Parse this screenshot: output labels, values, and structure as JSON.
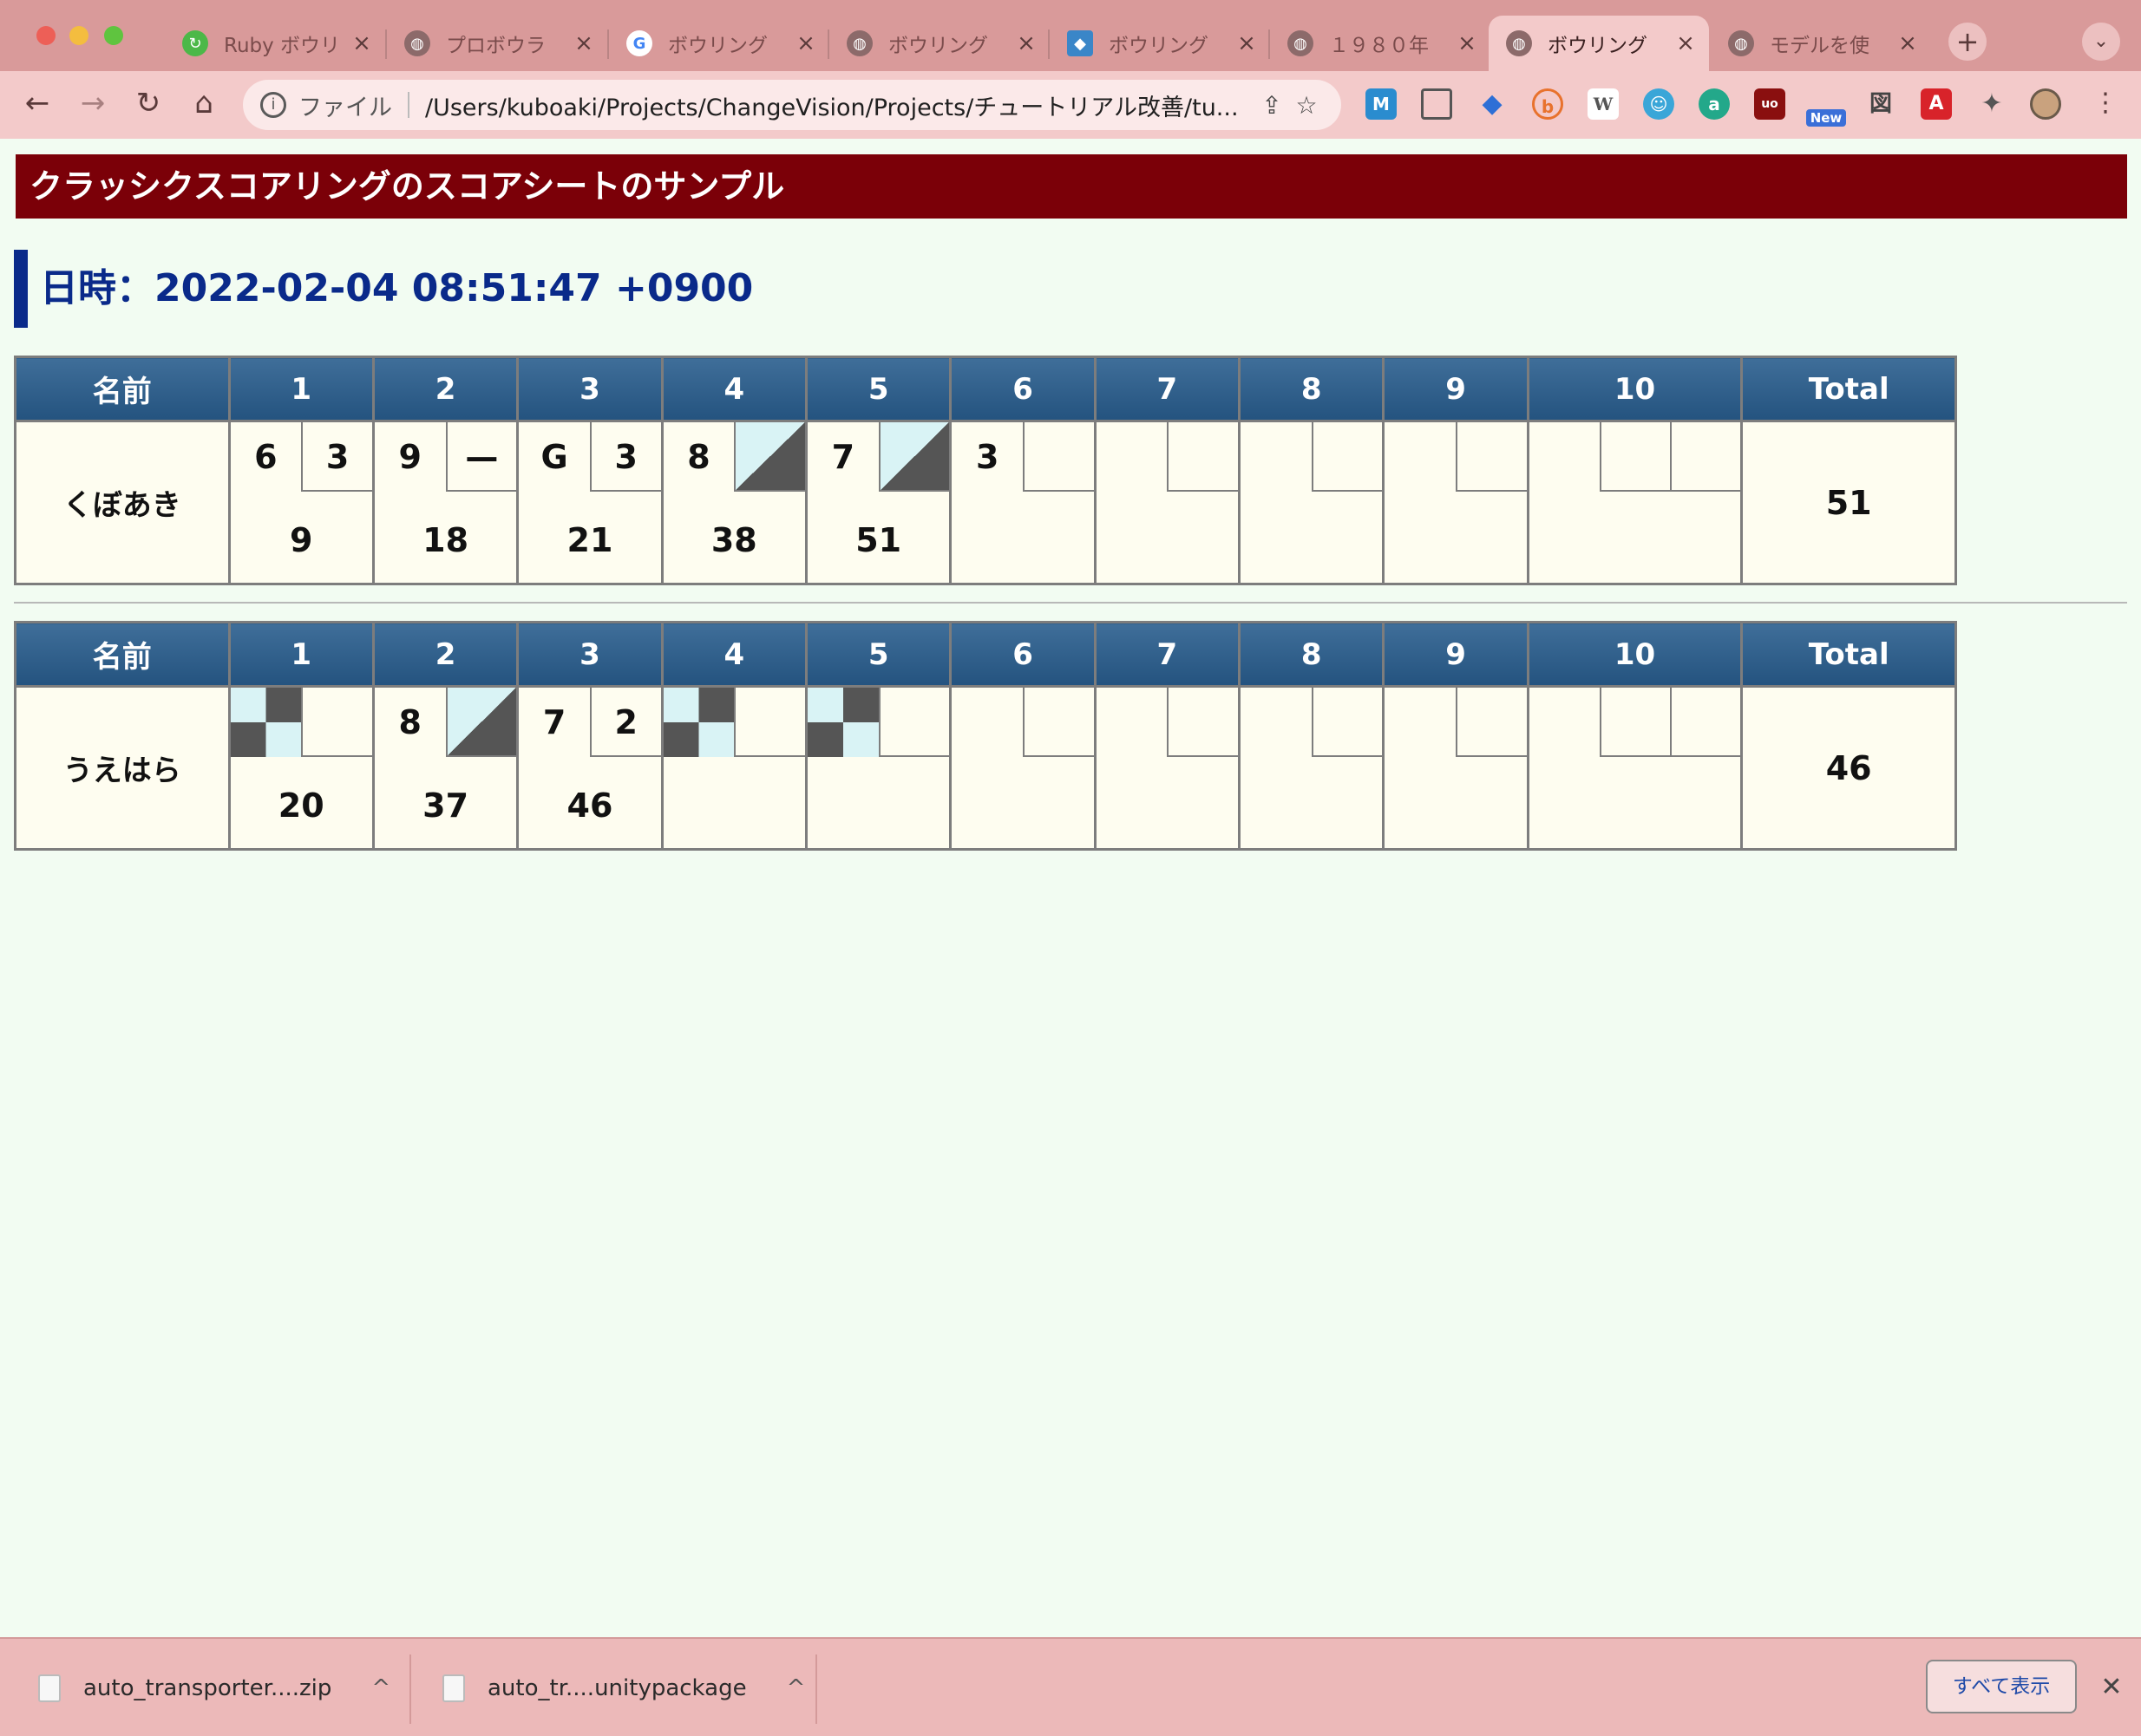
{
  "browser": {
    "tabs": [
      {
        "title": "Ruby ボウリ",
        "icon": "ruby-logo-icon"
      },
      {
        "title": "プロボウラ",
        "icon": "globe-icon"
      },
      {
        "title": "ボウリング",
        "icon": "google-icon"
      },
      {
        "title": "ボウリング",
        "icon": "globe-icon"
      },
      {
        "title": "ボウリング",
        "icon": "site-logo-icon"
      },
      {
        "title": "１９８０年",
        "icon": "globe-icon"
      },
      {
        "title": "ボウリング",
        "icon": "globe-icon",
        "active": true
      },
      {
        "title": "モデルを使",
        "icon": "globe-icon"
      }
    ],
    "address_scheme": "ファイル",
    "address_url": "/Users/kuboaki/Projects/ChangeVision/Projects/チュートリアル改善/tu...",
    "extensions": [
      {
        "name": "m-icon",
        "label": "M",
        "color": "#2a8ccf"
      },
      {
        "name": "screenshot-icon",
        "label": "▢",
        "color": "#555555"
      },
      {
        "name": "diamond-icon",
        "label": "◆",
        "color": "#2d6fd6"
      },
      {
        "name": "b-icon",
        "label": "b",
        "color": "#e8722d"
      },
      {
        "name": "w-icon",
        "label": "W",
        "color": "#999999"
      },
      {
        "name": "ghost-icon",
        "label": "0",
        "color": "#3aa6d8"
      },
      {
        "name": "a-icon",
        "label": "a",
        "color": "#23a88a"
      },
      {
        "name": "ublock-icon",
        "label": "uo",
        "color": "#8a0f0f"
      },
      {
        "name": "new-ext-icon",
        "label": "New",
        "color": "#3a6fd8"
      },
      {
        "name": "qr-icon",
        "label": "図",
        "color": "#444444"
      },
      {
        "name": "acrobat-icon",
        "label": "A",
        "color": "#d8232a"
      },
      {
        "name": "puzzle-icon",
        "label": "✦",
        "color": "#555555"
      }
    ]
  },
  "page": {
    "title": "クラッシクスコアリングのスコアシートのサンプル",
    "datetime": "日時：2022-02-04 08:51:47 +0900"
  },
  "sheet_headers": [
    "名前",
    "1",
    "2",
    "3",
    "4",
    "5",
    "6",
    "7",
    "8",
    "9",
    "10",
    "Total"
  ],
  "players": [
    {
      "name": "くぼあき",
      "frames": [
        {
          "r1": "6",
          "r2": "3",
          "mark": "",
          "score": "9"
        },
        {
          "r1": "9",
          "r2": "—",
          "mark": "",
          "score": "18"
        },
        {
          "r1": "G",
          "r2": "3",
          "mark": "",
          "score": "21"
        },
        {
          "r1": "8",
          "r2": "",
          "mark": "spare",
          "score": "38"
        },
        {
          "r1": "7",
          "r2": "",
          "mark": "spare",
          "score": "51"
        },
        {
          "r1": "3",
          "r2": "",
          "mark": "",
          "score": ""
        },
        {
          "r1": "",
          "r2": "",
          "mark": "",
          "score": ""
        },
        {
          "r1": "",
          "r2": "",
          "mark": "",
          "score": ""
        },
        {
          "r1": "",
          "r2": "",
          "mark": "",
          "score": ""
        }
      ],
      "total": "51"
    },
    {
      "name": "うえはら",
      "frames": [
        {
          "r1": "",
          "r2": "",
          "mark": "strike",
          "score": "20"
        },
        {
          "r1": "8",
          "r2": "",
          "mark": "spare",
          "score": "37"
        },
        {
          "r1": "7",
          "r2": "2",
          "mark": "",
          "score": "46"
        },
        {
          "r1": "",
          "r2": "",
          "mark": "strike",
          "score": ""
        },
        {
          "r1": "",
          "r2": "",
          "mark": "strike",
          "score": ""
        },
        {
          "r1": "",
          "r2": "",
          "mark": "",
          "score": ""
        },
        {
          "r1": "",
          "r2": "",
          "mark": "",
          "score": ""
        },
        {
          "r1": "",
          "r2": "",
          "mark": "",
          "score": ""
        },
        {
          "r1": "",
          "r2": "",
          "mark": "",
          "score": ""
        }
      ],
      "total": "46"
    }
  ],
  "downloads": [
    {
      "file": "auto_transporter....zip"
    },
    {
      "file": "auto_tr....unitypackage"
    }
  ],
  "download_bar": {
    "show_all": "すべて表示"
  },
  "colors": {
    "heading_bg": "#7b0008",
    "date_color": "#0a2a8a",
    "table_header": "#2f5f8b",
    "strike_dark": "#555555",
    "strike_light": "#d9f3f5"
  }
}
